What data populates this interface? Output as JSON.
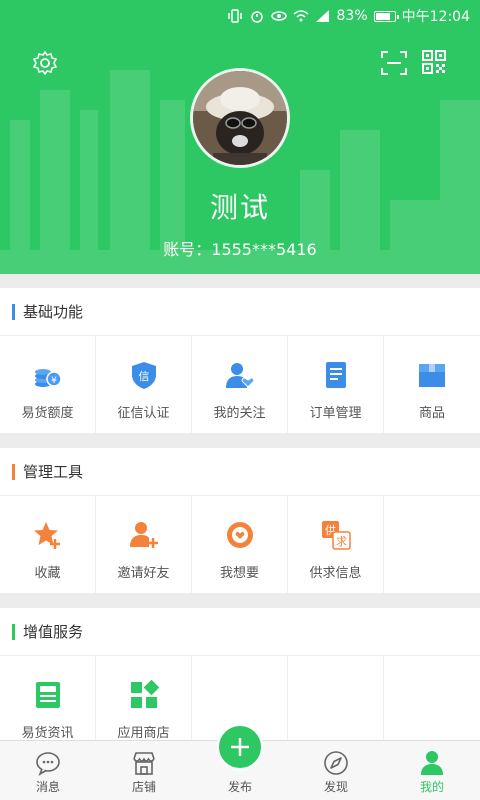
{
  "statusbar": {
    "battery": "83%",
    "time": "中午12:04"
  },
  "profile": {
    "name": "测试",
    "account": "账号：1555***5416"
  },
  "sections": [
    {
      "title": "基础功能",
      "color": "#3b8de8",
      "items": [
        {
          "label": "易货额度",
          "icon": "coins-icon"
        },
        {
          "label": "征信认证",
          "icon": "credit-shield-icon"
        },
        {
          "label": "我的关注",
          "icon": "follow-user-icon"
        },
        {
          "label": "订单管理",
          "icon": "order-doc-icon"
        },
        {
          "label": "商品",
          "icon": "box-icon"
        }
      ]
    },
    {
      "title": "管理工具",
      "color": "#f5823a",
      "items": [
        {
          "label": "收藏",
          "icon": "star-plus-icon"
        },
        {
          "label": "邀请好友",
          "icon": "invite-user-icon"
        },
        {
          "label": "我想要",
          "icon": "heart-badge-icon"
        },
        {
          "label": "供求信息",
          "icon": "supply-demand-icon"
        }
      ]
    },
    {
      "title": "增值服务",
      "color": "#2dc763",
      "items": [
        {
          "label": "易货资讯",
          "icon": "news-icon"
        },
        {
          "label": "应用商店",
          "icon": "app-store-icon"
        }
      ]
    }
  ],
  "nav": [
    {
      "label": "消息",
      "icon": "message-icon"
    },
    {
      "label": "店铺",
      "icon": "store-icon"
    },
    {
      "label": "发布",
      "icon": "plus-icon"
    },
    {
      "label": "发现",
      "icon": "compass-icon"
    },
    {
      "label": "我的",
      "icon": "user-icon",
      "active": true
    }
  ]
}
